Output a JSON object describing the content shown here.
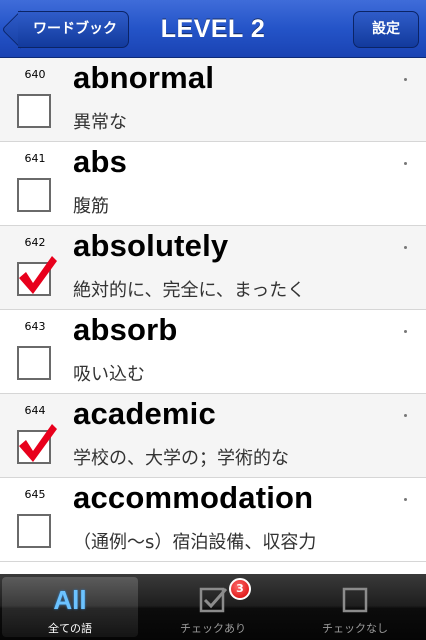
{
  "nav": {
    "back_label": "ワードブック",
    "title": "LEVEL 2",
    "settings_label": "設定",
    "bar_color": "#2454c8"
  },
  "list": {
    "items": [
      {
        "number": "640",
        "word": "abnormal",
        "meaning": "異常な",
        "checked": false
      },
      {
        "number": "641",
        "word": "abs",
        "meaning": "腹筋",
        "checked": false
      },
      {
        "number": "642",
        "word": "absolutely",
        "meaning": "絶対的に、完全に、まったく",
        "checked": true
      },
      {
        "number": "643",
        "word": "absorb",
        "meaning": "吸い込む",
        "checked": false
      },
      {
        "number": "644",
        "word": "academic",
        "meaning": "学校の、大学の；学術的な",
        "checked": true
      },
      {
        "number": "645",
        "word": "accommodation",
        "meaning": "（通例～s）宿泊設備、収容力",
        "checked": false
      }
    ],
    "check_color": "#e8001c"
  },
  "tabs": [
    {
      "icon_text": "All",
      "label": "全ての語",
      "selected": true
    },
    {
      "icon": "checked-box-icon",
      "label": "チェックあり",
      "badge": "3",
      "selected": false
    },
    {
      "icon": "empty-box-icon",
      "label": "チェックなし",
      "selected": false
    }
  ]
}
